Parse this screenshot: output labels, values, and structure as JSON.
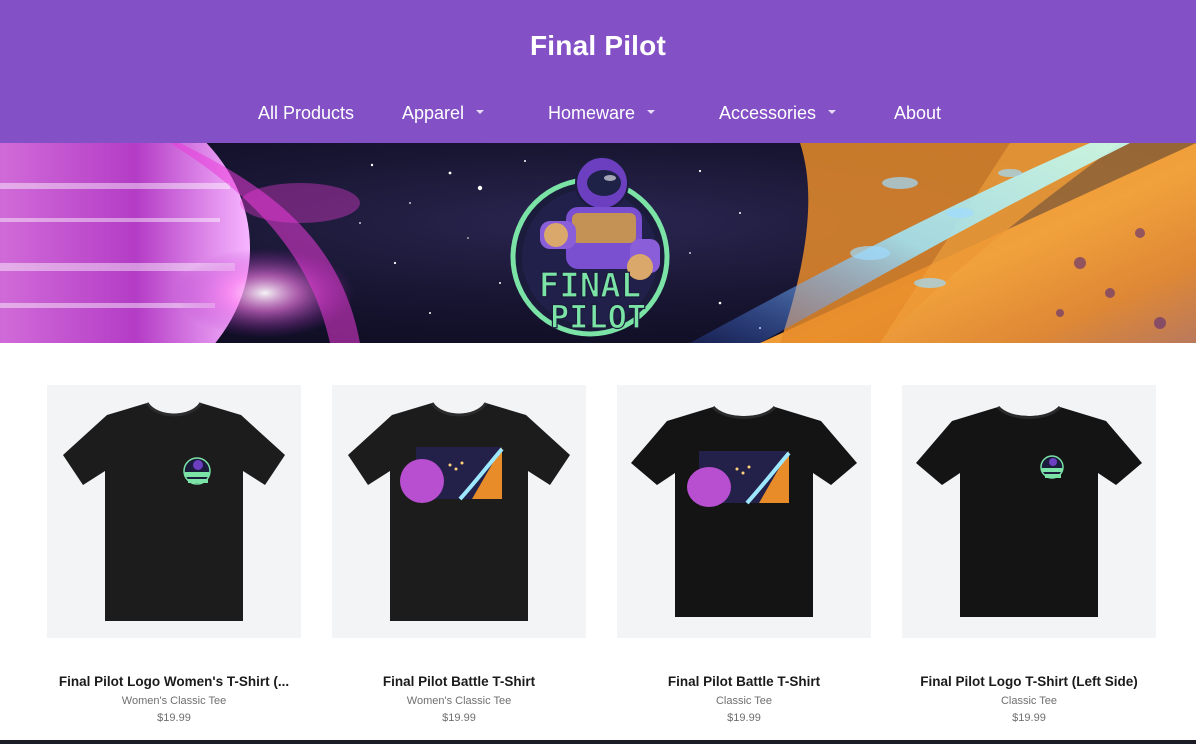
{
  "site": {
    "title": "Final Pilot"
  },
  "nav": {
    "items": [
      {
        "label": "All Products",
        "has_dropdown": false
      },
      {
        "label": "Apparel",
        "has_dropdown": true
      },
      {
        "label": "Homeware",
        "has_dropdown": true
      },
      {
        "label": "Accessories",
        "has_dropdown": true
      },
      {
        "label": "About",
        "has_dropdown": false
      }
    ]
  },
  "banner": {
    "logo_text_line1": "FINAL",
    "logo_text_line2": "PILOT"
  },
  "products": [
    {
      "title": "Final Pilot Logo Women's T-Shirt (...",
      "subtitle": "Women's Classic Tee",
      "price": "$19.99",
      "print": "logo",
      "fit": "womens"
    },
    {
      "title": "Final Pilot Battle T-Shirt",
      "subtitle": "Women's Classic Tee",
      "price": "$19.99",
      "print": "battle",
      "fit": "womens"
    },
    {
      "title": "Final Pilot Battle T-Shirt",
      "subtitle": "Classic Tee",
      "price": "$19.99",
      "print": "battle",
      "fit": "classic"
    },
    {
      "title": "Final Pilot Logo T-Shirt (Left Side)",
      "subtitle": "Classic Tee",
      "price": "$19.99",
      "print": "logo",
      "fit": "classic"
    }
  ],
  "colors": {
    "header_bg": "#8350c6",
    "card_bg": "#f3f4f6",
    "shirt": "#1c1c1c",
    "logo_green": "#7be3a6"
  }
}
